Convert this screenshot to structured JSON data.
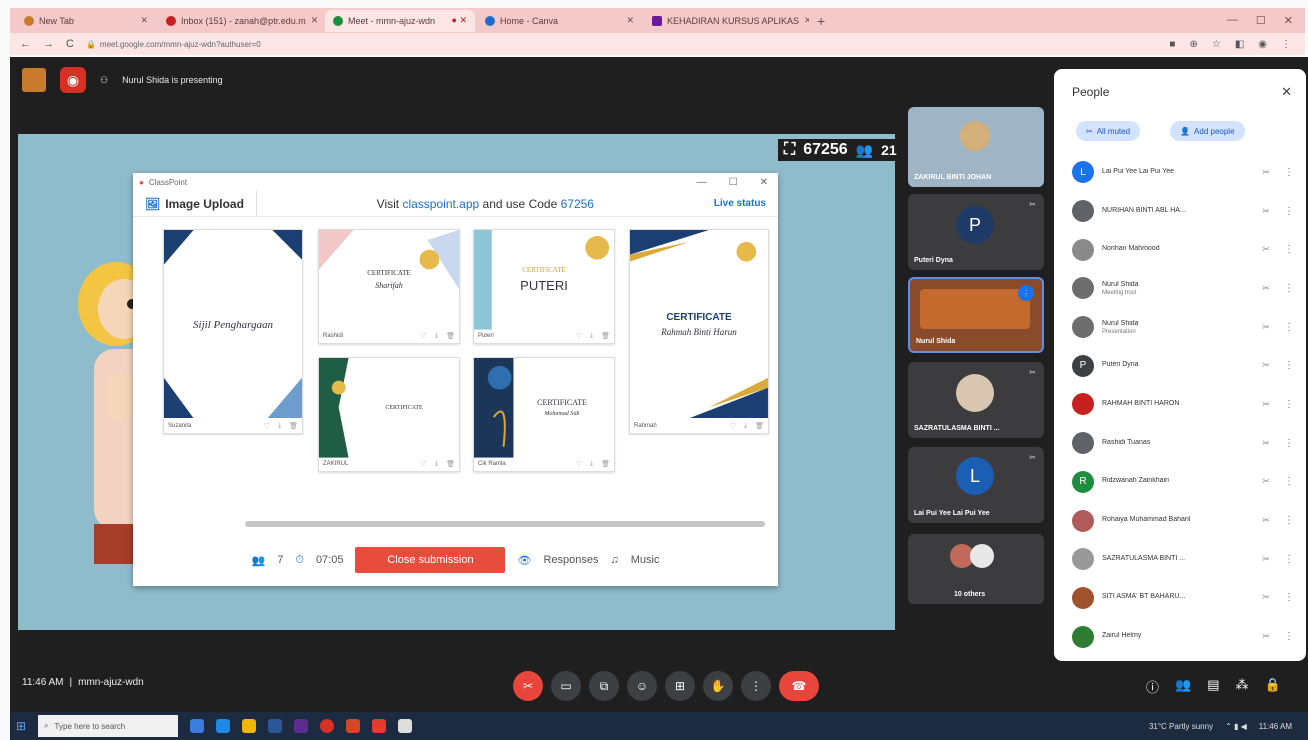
{
  "browser": {
    "tabs": [
      {
        "title": "New Tab",
        "color": "#c97a2c",
        "active": false
      },
      {
        "title": "Inbox (151) - zanah@ptr.edu.m",
        "color": "#c5221f",
        "active": false
      },
      {
        "title": "Meet - mmn-ajuz-wdn",
        "color": "#1e8e3e",
        "active": true
      },
      {
        "title": "Home - Canva",
        "color": "#1c6fd1",
        "active": false
      },
      {
        "title": "KEHADIRAN KURSUS APLIKAS",
        "color": "#6a1b9a",
        "active": false
      }
    ],
    "url": "meet.google.com/mmn-ajuz-wdn?authuser=0"
  },
  "meet": {
    "presenting_text": "Nurul Shida is presenting",
    "meeting_code_chip": "67256",
    "participants_count": "21",
    "time": "11:46 AM",
    "meeting_code": "mmn-ajuz-wdn"
  },
  "classpoint": {
    "app_title": "ClassPoint",
    "tab_label": "Image Upload",
    "visit_prefix": "Visit",
    "visit_link": "classpoint.app",
    "visit_mid": "and use Code",
    "visit_code": "67256",
    "live_status": "Live status",
    "submission_count": "7",
    "timer": "07:05",
    "close_label": "Close submission",
    "responses_label": "Responses",
    "music_label": "Music",
    "cards": [
      {
        "name": "Suzanita",
        "heading": "Sijil Penghargaan",
        "sub": ""
      },
      {
        "name": "Rashidi",
        "heading": "CERTIFICATE",
        "sub": "Sharifah"
      },
      {
        "name": "Puteri",
        "heading": "CERTIFICATE",
        "sub": "PUTERI"
      },
      {
        "name": "Rahmah",
        "heading": "CERTIFICATE",
        "sub": "Rahmah Binti Harun"
      },
      {
        "name": "ZAKIRUL",
        "heading": "CERTIFICATE",
        "sub": ""
      },
      {
        "name": "Cik Ramla",
        "heading": "CERTIFICATE",
        "sub": "Mohamad Sidi"
      }
    ]
  },
  "tiles": [
    {
      "name": "ZAKIRUL BINTI JOHAN",
      "avatar": ""
    },
    {
      "name": "Puteri Dyna",
      "avatar": "P"
    },
    {
      "name": "Nurul Shida",
      "avatar": ""
    },
    {
      "name": "SAZRATULASMA BINTI ...",
      "avatar": ""
    },
    {
      "name": "Lai Pui Yee Lai Pui Yee",
      "avatar": "L"
    },
    {
      "name": "10 others",
      "avatar": ""
    }
  ],
  "people": {
    "title": "People",
    "mute_all": "All muted",
    "add_people": "Add people",
    "list": [
      {
        "name": "Lai Pui Yee Lai Pui Yee",
        "role": "",
        "avatar": "L",
        "color": "#1a73e8"
      },
      {
        "name": "NURIHAN BINTI ABL HA...",
        "role": "",
        "avatar": "",
        "color": "#5f6368"
      },
      {
        "name": "Norihan Mahmood",
        "role": "",
        "avatar": "",
        "color": "#8a8a8a"
      },
      {
        "name": "Nurul Shida",
        "role": "Meeting host",
        "avatar": "",
        "color": "#6d6d6d"
      },
      {
        "name": "Nurul Shida",
        "role": "Presentation",
        "avatar": "",
        "color": "#6d6d6d"
      },
      {
        "name": "Puteri Dyna",
        "role": "",
        "avatar": "P",
        "color": "#3c4043"
      },
      {
        "name": "RAHMAH BINTI HARON",
        "role": "",
        "avatar": "",
        "color": "#c5221f"
      },
      {
        "name": "Rashidi Tuanas",
        "role": "",
        "avatar": "",
        "color": "#5f6368"
      },
      {
        "name": "Ridzwanah Zainkhairi",
        "role": "",
        "avatar": "R",
        "color": "#1e8e3e"
      },
      {
        "name": "Rohaiya Muhammad Baharil",
        "role": "",
        "avatar": "",
        "color": "#b05a5a"
      },
      {
        "name": "SAZRATULASMA BINTI ...",
        "role": "",
        "avatar": "",
        "color": "#999999"
      },
      {
        "name": "SITI ASMA' BT BAHARU...",
        "role": "",
        "avatar": "",
        "color": "#a0522d"
      },
      {
        "name": "Zairul Helmy",
        "role": "",
        "avatar": "",
        "color": "#2e7d32"
      }
    ]
  },
  "taskbar": {
    "search_placeholder": "Type here to search",
    "weather": "31°C Partly sunny",
    "clock": "11:46 AM"
  }
}
